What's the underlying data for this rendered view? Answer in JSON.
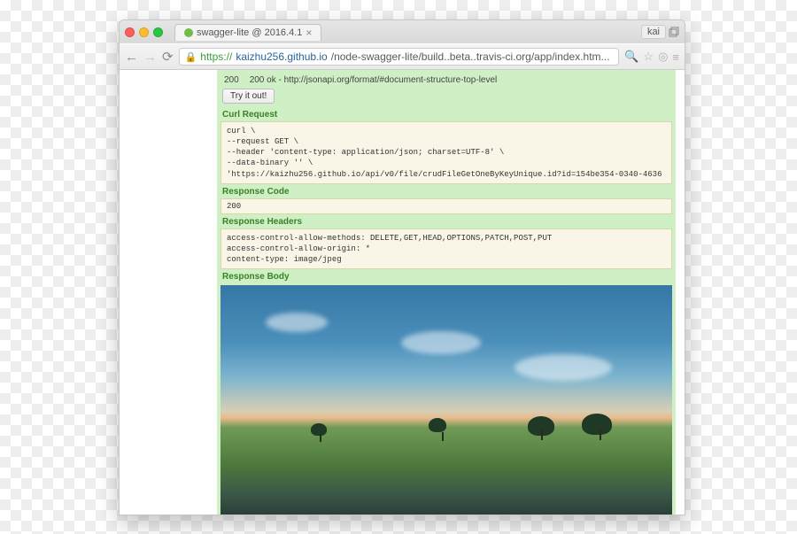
{
  "tab": {
    "title": "swagger-lite @ 2016.4.1"
  },
  "user_button": "kai",
  "url": {
    "protocol": "https",
    "domain": "kaizhu256.github.io",
    "path": "/node-swagger-lite/build..beta..travis-ci.org/app/index.htm..."
  },
  "status_row": {
    "code": "200",
    "text": "200 ok - http://jsonapi.org/format/#document-structure-top-level"
  },
  "try_button": "Try it out!",
  "sections": {
    "curl": {
      "label": "Curl Request",
      "body": "curl \\\n--request GET \\\n--header 'content-type: application/json; charset=UTF-8' \\\n--data-binary '' \\\n'https://kaizhu256.github.io/api/v0/file/crudFileGetOneByKeyUnique.id?id=154be354-0340-4636"
    },
    "code": {
      "label": "Response Code",
      "body": "200"
    },
    "headers": {
      "label": "Response Headers",
      "body": "access-control-allow-methods: DELETE,GET,HEAD,OPTIONS,PATCH,POST,PUT\naccess-control-allow-origin: *\ncontent-type: image/jpeg"
    },
    "body": {
      "label": "Response Body"
    }
  }
}
